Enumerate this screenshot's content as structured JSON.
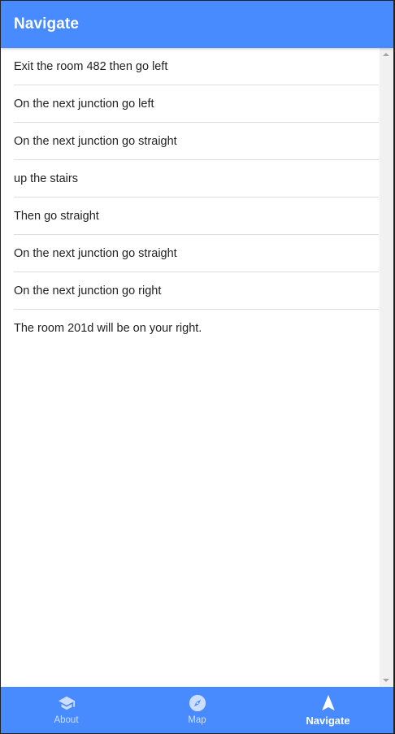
{
  "header": {
    "title": "Navigate"
  },
  "directions": [
    "Exit the room 482 then go left",
    "On the next junction go left",
    "On the next junction go straight",
    "up the stairs",
    "Then go straight",
    "On the next junction go straight",
    "On the next junction go right",
    "The room 201d will be on your right."
  ],
  "tabs": [
    {
      "label": "About",
      "icon": "school-icon",
      "selected": false
    },
    {
      "label": "Map",
      "icon": "compass-icon",
      "selected": false
    },
    {
      "label": "Navigate",
      "icon": "navigate-icon",
      "selected": true
    }
  ],
  "colors": {
    "primary": "#488aff",
    "divider": "#dedede"
  }
}
